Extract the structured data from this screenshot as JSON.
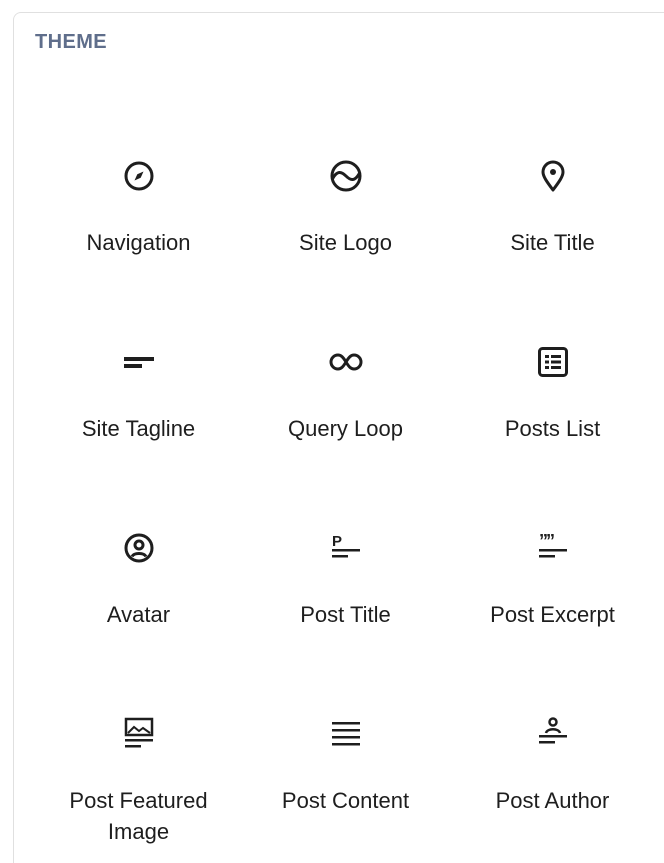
{
  "section": {
    "title": "THEME"
  },
  "blocks": [
    {
      "label": "Navigation",
      "icon": "compass-icon"
    },
    {
      "label": "Site Logo",
      "icon": "site-logo-icon"
    },
    {
      "label": "Site Title",
      "icon": "map-marker-icon"
    },
    {
      "label": "Site Tagline",
      "icon": "tagline-icon"
    },
    {
      "label": "Query Loop",
      "icon": "loop-icon"
    },
    {
      "label": "Posts List",
      "icon": "post-list-icon"
    },
    {
      "label": "Avatar",
      "icon": "avatar-icon"
    },
    {
      "label": "Post Title",
      "icon": "post-title-icon"
    },
    {
      "label": "Post Excerpt",
      "icon": "post-excerpt-icon"
    },
    {
      "label": "Post Featured Image",
      "icon": "featured-image-icon"
    },
    {
      "label": "Post Content",
      "icon": "post-content-icon"
    },
    {
      "label": "Post Author",
      "icon": "post-author-icon"
    }
  ],
  "colors": {
    "section_title": "#5f6e8b",
    "icon": "#1e1e1e",
    "label": "#1e1e1e",
    "border": "#e0e0e0"
  }
}
